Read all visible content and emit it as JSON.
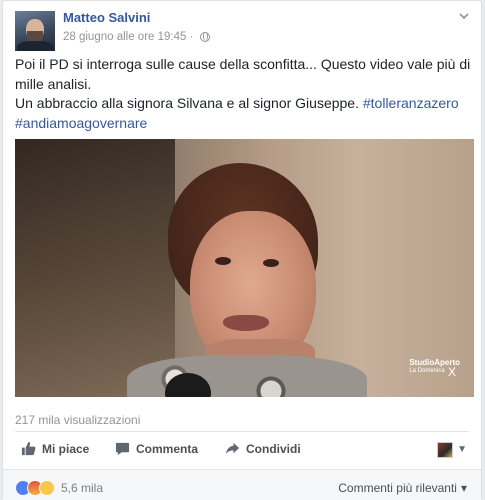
{
  "post": {
    "author": "Matteo Salvini",
    "timestamp": "28 giugno alle ore 19:45 ·",
    "text_line1": "Poi il PD si interroga sulle cause della sconfitta... Questo video vale più di",
    "text_line2": "mille analisi.",
    "text_line3_prefix": "Un abbraccio alla signora Silvana e al signor Giuseppe.",
    "hashtag1": "#tolleranzazero",
    "hashtag2": "#andiamoagovernare"
  },
  "video": {
    "watermark_line1": "StudioAperto",
    "watermark_line2": "La Domenica",
    "watermark_mark": "X"
  },
  "stats": {
    "views": "217 mila visualizzazioni",
    "reactions_count": "5,6 mila"
  },
  "actions": {
    "like": "Mi piace",
    "comment": "Commenta",
    "share": "Condividi"
  },
  "footer": {
    "sort": "Commenti più rilevanti"
  },
  "icons": {
    "menu": "chevron-down-icon",
    "privacy": "globe-icon",
    "like": "thumbs-up-icon",
    "comment": "comment-bubble-icon",
    "share": "share-arrow-icon"
  },
  "colors": {
    "link": "#365899",
    "meta": "#90949c",
    "action": "#4b4f56"
  }
}
